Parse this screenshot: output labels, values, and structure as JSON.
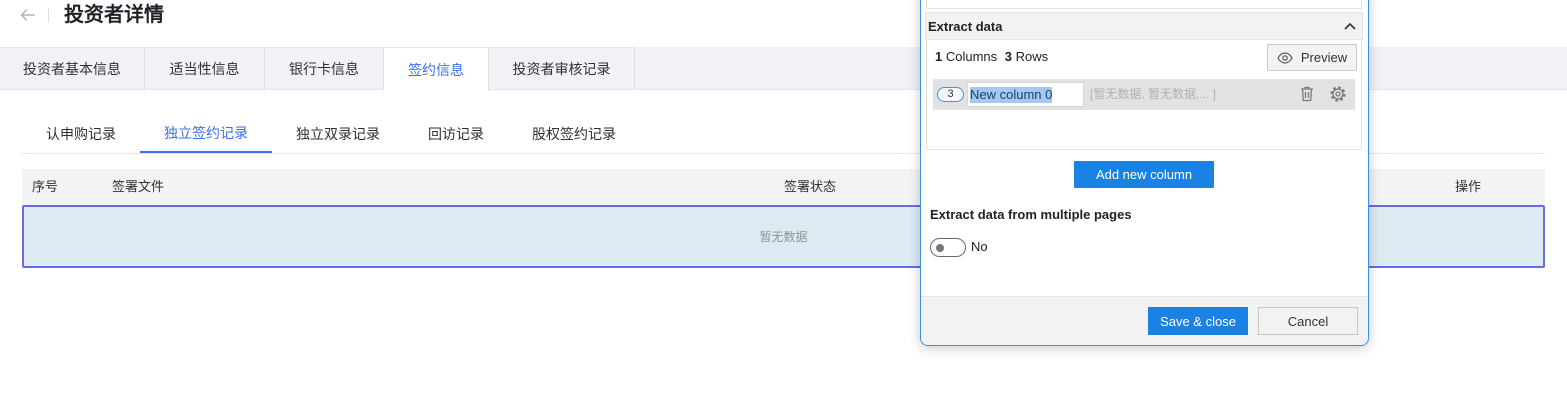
{
  "page": {
    "title": "投资者详情"
  },
  "main_tabs": [
    {
      "label": "投资者基本信息",
      "active": false
    },
    {
      "label": "适当性信息",
      "active": false
    },
    {
      "label": "银行卡信息",
      "active": false
    },
    {
      "label": "签约信息",
      "active": true
    },
    {
      "label": "投资者审核记录",
      "active": false
    }
  ],
  "sub_tabs": [
    {
      "label": "认申购记录",
      "active": false
    },
    {
      "label": "独立签约记录",
      "active": true
    },
    {
      "label": "独立双录记录",
      "active": false
    },
    {
      "label": "回访记录",
      "active": false
    },
    {
      "label": "股权签约记录",
      "active": false
    }
  ],
  "table": {
    "columns": [
      "序号",
      "签署文件",
      "签署状态",
      "操作"
    ],
    "empty_text": "暂无数据",
    "selected": true
  },
  "extract_panel": {
    "section_title": "Extract data",
    "expanded": true,
    "summary": {
      "columns_count": "1",
      "columns_label": "Columns",
      "rows_count": "3",
      "rows_label": "Rows"
    },
    "preview_label": "Preview",
    "columns": [
      {
        "badge": "3",
        "name": "New column 0",
        "name_selected": true,
        "sample": "[暂无数据, 暂无数据,... ]"
      }
    ],
    "add_column_label": "Add new column",
    "multi_page": {
      "title": "Extract data from multiple pages",
      "enabled": false,
      "state_label": "No"
    },
    "save_label": "Save & close",
    "cancel_label": "Cancel"
  },
  "icons": {
    "back": "arrow-left-icon",
    "collapse": "chevron-up-icon",
    "preview": "eye-icon",
    "delete_column": "trash-icon",
    "column_settings": "gear-icon"
  },
  "colors": {
    "page_accent": "#3a6ff0",
    "tool_primary": "#1a82e2",
    "panel_border": "#3c8ee0",
    "selection_outline": "#6b6be0",
    "selection_fill": "#dcebf2",
    "text_selection": "#a5c8f0"
  }
}
